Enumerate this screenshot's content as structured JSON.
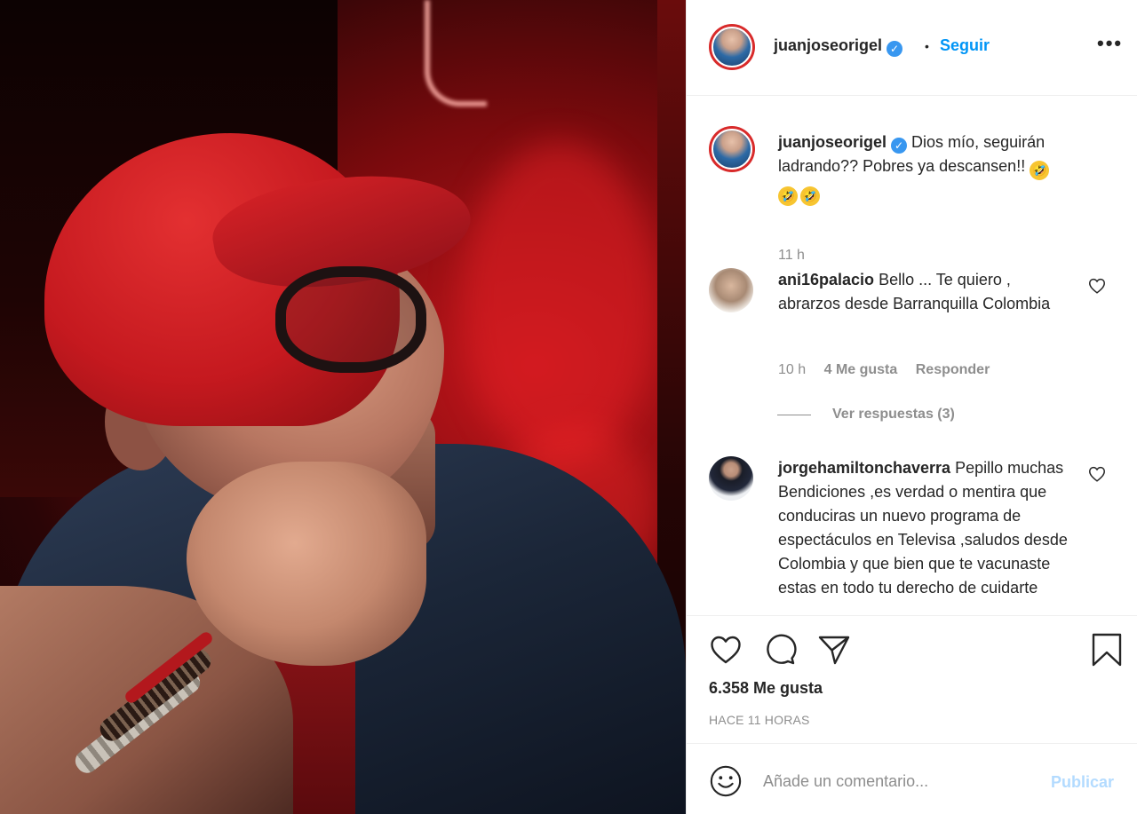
{
  "post": {
    "photo_alt": "Man in red cap and glasses looking up against red neon background"
  },
  "header": {
    "username": "juanjoseorigel",
    "verified_mark": "✓",
    "dot": "•",
    "follow_label": "Seguir",
    "more_label": "•••"
  },
  "caption": {
    "username": "juanjoseorigel",
    "text": "Dios mío, seguirán ladrando?? Pobres ya descansen!!",
    "emoji_count": 3,
    "emoji_glyph": "🤣",
    "time": "11 h"
  },
  "comments": [
    {
      "username": "ani16palacio",
      "text": "Bello ... Te quiero , abrarzos desde Barranquilla Colombia",
      "time": "10 h",
      "likes": "4 Me gusta",
      "reply_label": "Responder",
      "view_replies": "Ver respuestas (3)"
    },
    {
      "username": "jorgehamiltonchaverra",
      "text": "Pepillo muchas Bendiciones ,es verdad o mentira que conduciras un nuevo programa de espectáculos en Televisa ,saludos desde Colombia y que bien que te vacunaste estas en todo tu derecho de cuidarte"
    }
  ],
  "actions": {
    "icons": [
      "heart-icon",
      "comment-icon",
      "share-icon",
      "bookmark-icon"
    ],
    "likes_count": "6.358 Me gusta",
    "age": "HACE 11 HORAS"
  },
  "composer": {
    "placeholder": "Añade un comentario...",
    "publish_label": "Publicar"
  },
  "colors": {
    "accent_blue": "#0095f6",
    "publish_disabled": "#b3dbff",
    "verified_blue": "#3897f0",
    "muted_text": "#8e8e8e",
    "text": "#262626"
  }
}
